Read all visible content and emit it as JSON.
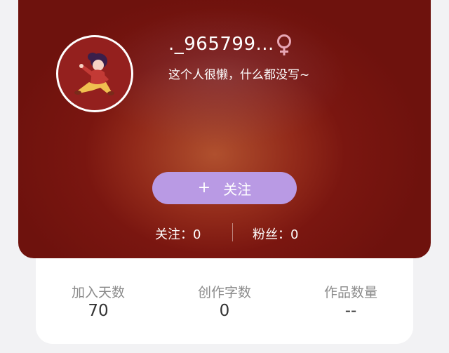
{
  "profile": {
    "username": "._965799...",
    "gender_icon": "female-symbol-icon",
    "bio": "这个人很懒，什么都没写~",
    "follow_button": {
      "icon": "+",
      "label": "关注"
    },
    "following": "关注：0",
    "fans": "粉丝：0"
  },
  "stats": [
    {
      "label": "加入天数",
      "value": "70"
    },
    {
      "label": "创作字数",
      "value": "0"
    },
    {
      "label": "作品数量",
      "value": "--"
    }
  ],
  "colors": {
    "card_background": "#7a1610",
    "follow_button": "#b99ae4",
    "gender_icon": "#e7a6b4"
  }
}
